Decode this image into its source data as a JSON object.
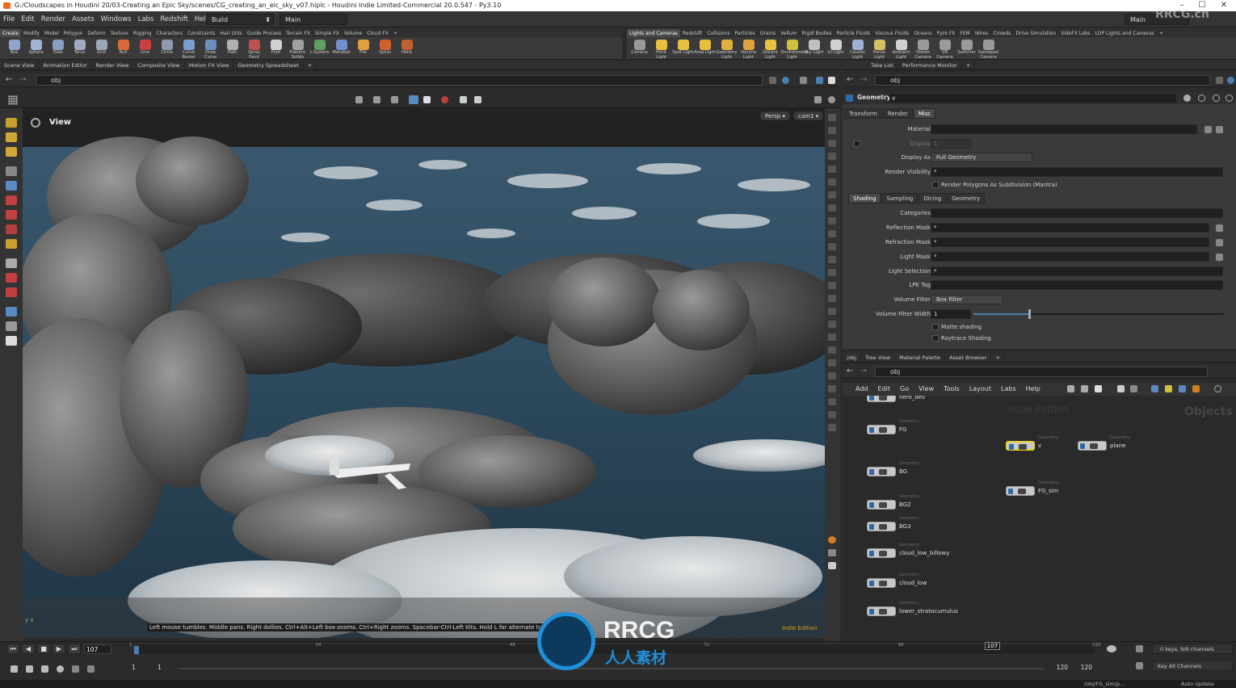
{
  "window": {
    "title": "G:/Cloudscapes in Houdini 20/03-Creating an Epic Sky/scenes/CG_creating_an_eic_sky_v07.hiplc - Houdini Indie Limited-Commercial 20.0.547 - Py3.10",
    "minimize": "–",
    "maximize": "☐",
    "close": "✕"
  },
  "menu": {
    "items": [
      "File",
      "Edit",
      "Render",
      "Assets",
      "Windows",
      "Labs",
      "Redshift",
      "Help"
    ],
    "desktop": "Build",
    "desktop_arrow": "⬍",
    "main": "Main",
    "main_right": "Main"
  },
  "shelf_tabs_left": [
    "Create",
    "Modify",
    "Model",
    "Polygon",
    "Deform",
    "Texture",
    "Rigging",
    "Characters",
    "Constraints",
    "Hair Utils",
    "Guide Process",
    "Terrain FX",
    "Simple FX",
    "Volume",
    "Cloud FX",
    "+"
  ],
  "shelf_tools_left": [
    {
      "label": "Box",
      "color": "#8fa5c9"
    },
    {
      "label": "Sphere",
      "color": "#9fb3d4"
    },
    {
      "label": "Tube",
      "color": "#8aa0c2"
    },
    {
      "label": "Torus",
      "color": "#a0a9c0"
    },
    {
      "label": "Grid",
      "color": "#9ba6b8"
    },
    {
      "label": "Null",
      "color": "#d86a3a"
    },
    {
      "label": "Line",
      "color": "#c84040"
    },
    {
      "label": "Circle",
      "color": "#8d9ab0"
    },
    {
      "label": "Curve Bezier",
      "color": "#7a9fd0"
    },
    {
      "label": "Draw Curve",
      "color": "#6e8ec0"
    },
    {
      "label": "Path",
      "color": "#b0b0b0"
    },
    {
      "label": "Spray Paint",
      "color": "#c05050"
    },
    {
      "label": "Font",
      "color": "#d0d0d0"
    },
    {
      "label": "Platonic Solids",
      "color": "#a0a0a0"
    },
    {
      "label": "L-System",
      "color": "#5f9f5f"
    },
    {
      "label": "Metaball",
      "color": "#6f8fd0"
    },
    {
      "label": "File",
      "color": "#e0a040"
    },
    {
      "label": "Spiral",
      "color": "#d06030"
    },
    {
      "label": "Helix",
      "color": "#c06030"
    }
  ],
  "shelf_tabs_right": [
    "Lights and Cameras",
    "Redshift",
    "Collisions",
    "Particles",
    "Grains",
    "Vellum",
    "Rigid Bodies",
    "Particle Fluids",
    "Viscous Fluids",
    "Oceans",
    "Pyro FX",
    "FEM",
    "Wires",
    "Crowds",
    "Drive Simulation",
    "SideFX Labs",
    "LOP Lights and Cameras",
    "+"
  ],
  "shelf_tools_right": [
    {
      "label": "Camera",
      "color": "#9a9a9a"
    },
    {
      "label": "Point Light",
      "color": "#e8c040"
    },
    {
      "label": "Spot Light",
      "color": "#e8c040"
    },
    {
      "label": "Area Light",
      "color": "#e8c040"
    },
    {
      "label": "Geometry Light",
      "color": "#e0b040"
    },
    {
      "label": "Volume Light",
      "color": "#e0a040"
    },
    {
      "label": "Distant Light",
      "color": "#e8c040"
    },
    {
      "label": "Environment Light",
      "color": "#d0c040"
    },
    {
      "label": "Sky Light",
      "color": "#c0c0c0"
    },
    {
      "label": "GI Light",
      "color": "#d0d0d0"
    },
    {
      "label": "Caustic Light",
      "color": "#a0b0d0"
    },
    {
      "label": "Portal Light",
      "color": "#d0c060"
    },
    {
      "label": "Ambient Light",
      "color": "#d0d0d0"
    },
    {
      "label": "Stereo Camera",
      "color": "#9a9a9a"
    },
    {
      "label": "VR Camera",
      "color": "#9a9a9a"
    },
    {
      "label": "Switcher",
      "color": "#9a9a9a"
    },
    {
      "label": "Gamepad Camera",
      "color": "#9a9a9a"
    }
  ],
  "viewport_tabs": [
    "Scene View",
    "Animation Editor",
    "Render View",
    "Composite View",
    "Motion FX View",
    "Geometry Spreadsheet",
    "+"
  ],
  "right_tabs": [
    "Take List",
    "Performance Monitor",
    "+"
  ],
  "path": {
    "value": "obj"
  },
  "viewport": {
    "label": "View",
    "persp": "Persp ▾",
    "cam": "cam1 ▾",
    "hint": "Left mouse tumbles. Middle pans. Right dollies. Ctrl+Alt+Left box-zooms. Ctrl+Right zooms. Spacebar-Ctrl-Left tilts. Hold L for alternate tumble",
    "edition": "Indie Edition",
    "gizmo": "y x"
  },
  "params": {
    "node_type": "Geometry",
    "node_name": "v",
    "tabs": [
      "Transform",
      "Render",
      "Misc"
    ],
    "material_label": "Material",
    "display_label": "Display",
    "display_value": "1",
    "display_as_label": "Display As",
    "display_as_value": "Full Geometry",
    "render_visibility_label": "Render Visibility",
    "render_visibility_value": "*",
    "render_polys_label": "Render Polygons As Subdivision (Mantra)",
    "subtabs": [
      "Shading",
      "Sampling",
      "Dicing",
      "Geometry"
    ],
    "categories_label": "Categories",
    "reflection_mask_label": "Reflection Mask",
    "reflection_mask_value": "*",
    "refraction_mask_label": "Refraction Mask",
    "refraction_mask_value": "*",
    "light_mask_label": "Light Mask",
    "light_mask_value": "*",
    "light_selection_label": "Light Selection",
    "light_selection_value": "*",
    "lpe_tag_label": "LPE Tag",
    "volume_filter_label": "Volume Filter",
    "volume_filter_value": "Box Filter",
    "volume_filter_width_label": "Volume Filter Width",
    "volume_filter_width_value": "1",
    "volume_filter_width_slider": 0.22,
    "matte_label": "Matte shading",
    "raytrace_label": "Raytrace Shading"
  },
  "net_tabs": [
    "/obj",
    "Tree View",
    "Material Palette",
    "Asset Browser",
    "+"
  ],
  "net_path": "obj",
  "net_menu": [
    "Add",
    "Edit",
    "Go",
    "View",
    "Tools",
    "Layout",
    "Labs",
    "Help"
  ],
  "net_watermark_edition": "Indie Edition",
  "net_watermark_context": "Objects",
  "nodes": [
    {
      "name": "hero_dev",
      "type": ""
    },
    {
      "name": "FG",
      "type": "Geometry"
    },
    {
      "name": "v",
      "type": "Geometry"
    },
    {
      "name": "plane",
      "type": "Geometry"
    },
    {
      "name": "BG",
      "type": "Geometry"
    },
    {
      "name": "FG_sim",
      "type": "Geometry"
    },
    {
      "name": "BG2",
      "type": "Geometry"
    },
    {
      "name": "BG3",
      "type": "Geometry"
    },
    {
      "name": "cloud_low_billowy",
      "type": "Geometry"
    },
    {
      "name": "cloud_low",
      "type": "Geometry"
    },
    {
      "name": "lower_stratocumulus",
      "type": "Geometry"
    }
  ],
  "timeline": {
    "current_frame": "107",
    "ticks": [
      "1",
      "24",
      "48",
      "72",
      "96",
      "120"
    ],
    "start": "1",
    "start2": "1",
    "end": "120",
    "end2": "120",
    "marker": "107",
    "keys_info": "0 keys, 9/9 channels",
    "key_all": "Key All Channels",
    "auto_update": "Auto Update",
    "status_path": "/obj/FG_sim/p..."
  },
  "watermark": {
    "brand": "RRCG",
    "sub": "人人素材",
    "corner": "RRCG.cn"
  }
}
